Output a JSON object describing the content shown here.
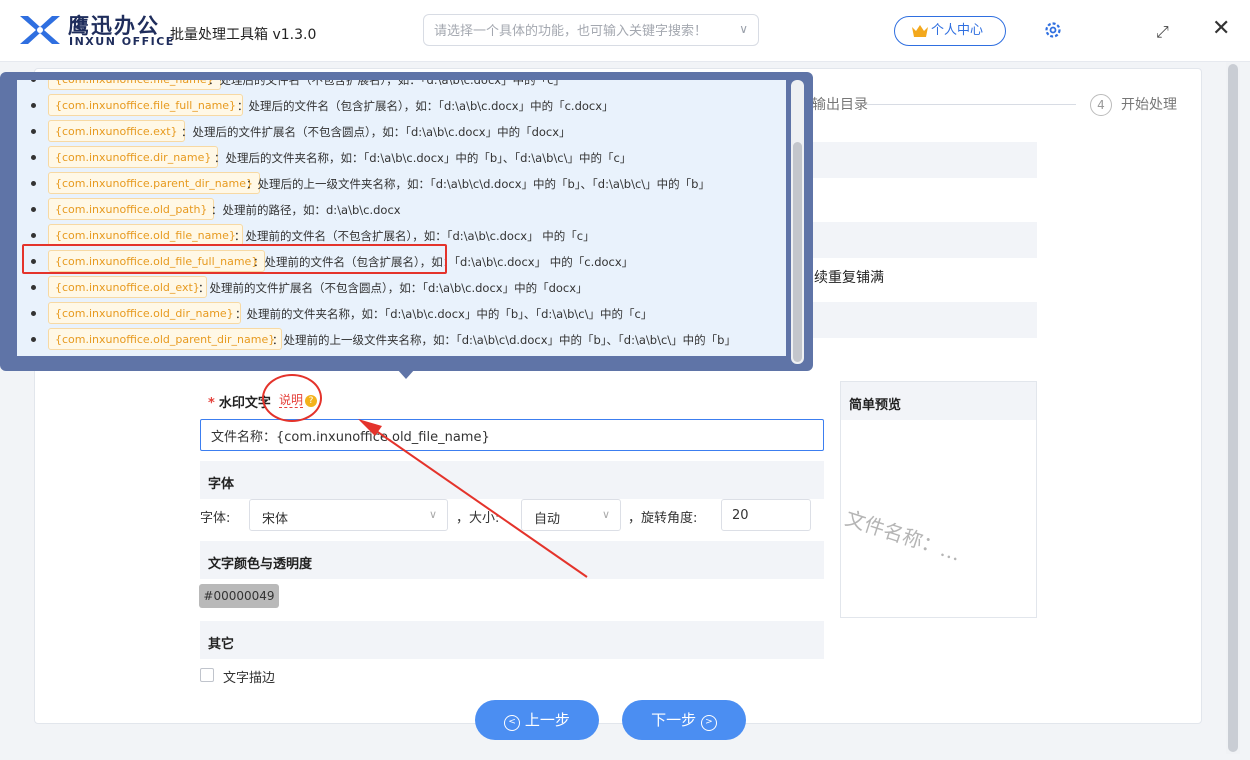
{
  "header": {
    "brand_cn": "鹰迅办公",
    "brand_en": "INXUN OFFICE",
    "app_title": "批量处理工具箱 v1.3.0",
    "search_placeholder": "请选择一个具体的功能，也可输入关键字搜索！",
    "user_center": "个人中心"
  },
  "steps": [
    {
      "label": "输出目录"
    },
    {
      "num": "4",
      "label": "开始处理"
    }
  ],
  "partial_option_text": "续重复铺满",
  "popover": {
    "items": [
      {
        "tag": "{com.inxunoffice.file_name}",
        "desc": "：处理后的文件名（不包含扩展名），如：「d:\\a\\b\\c.docx」中的「c」"
      },
      {
        "tag": "{com.inxunoffice.file_full_name}",
        "desc": "：处理后的文件名（包含扩展名），如：「d:\\a\\b\\c.docx」中的「c.docx」"
      },
      {
        "tag": "{com.inxunoffice.ext}",
        "desc": "：处理后的文件扩展名（不包含圆点），如：「d:\\a\\b\\c.docx」中的「docx」"
      },
      {
        "tag": "{com.inxunoffice.dir_name}",
        "desc": "：处理后的文件夹名称，如：「d:\\a\\b\\c.docx」中的「b」、「d:\\a\\b\\c\\」中的「c」"
      },
      {
        "tag": "{com.inxunoffice.parent_dir_name}",
        "desc": "：处理后的上一级文件夹名称，如：「d:\\a\\b\\c\\d.docx」中的「b」、「d:\\a\\b\\c\\」中的「b」"
      },
      {
        "tag": "{com.inxunoffice.old_path}",
        "desc": "：处理前的路径，如：d:\\a\\b\\c.docx"
      },
      {
        "tag": "{com.inxunoffice.old_file_name}",
        "desc": "：处理前的文件名（不包含扩展名），如：「d:\\a\\b\\c.docx」 中的「c」"
      },
      {
        "tag": "{com.inxunoffice.old_file_full_name}",
        "desc": "：处理前的文件名（包含扩展名），如：「d:\\a\\b\\c.docx」 中的「c.docx」"
      },
      {
        "tag": "{com.inxunoffice.old_ext}",
        "desc": "：处理前的文件扩展名（不包含圆点），如：「d:\\a\\b\\c.docx」中的「docx」"
      },
      {
        "tag": "{com.inxunoffice.old_dir_name}",
        "desc": "：处理前的文件夹名称，如：「d:\\a\\b\\c.docx」中的「b」、「d:\\a\\b\\c\\」中的「c」"
      },
      {
        "tag": "{com.inxunoffice.old_parent_dir_name}",
        "desc": "：处理前的上一级文件夹名称，如：「d:\\a\\b\\c\\d.docx」中的「b」、「d:\\a\\b\\c\\」中的「b」"
      }
    ]
  },
  "form": {
    "watermark_label": "水印文字",
    "help_link": "说明",
    "watermark_value": "文件名称：{com.inxunoffice.old_file_name}",
    "font_section": "字体",
    "font_label": "字体:",
    "font_value": "宋体",
    "size_label": "，大小:",
    "size_value": "自动",
    "rotate_label": "，旋转角度:",
    "rotate_value": "20",
    "color_section": "文字颜色与透明度",
    "color_value": "#00000049",
    "other_section": "其它",
    "stroke_label": "文字描边"
  },
  "preview": {
    "title": "简单预览",
    "watermark_text": "文件名称：…"
  },
  "buttons": {
    "prev": "上一步",
    "next": "下一步"
  },
  "colors": {
    "accent": "#4b8ef2",
    "popover_bg": "#5f74a7",
    "highlight": "#e4332b",
    "tag_text": "#e79a1f"
  }
}
